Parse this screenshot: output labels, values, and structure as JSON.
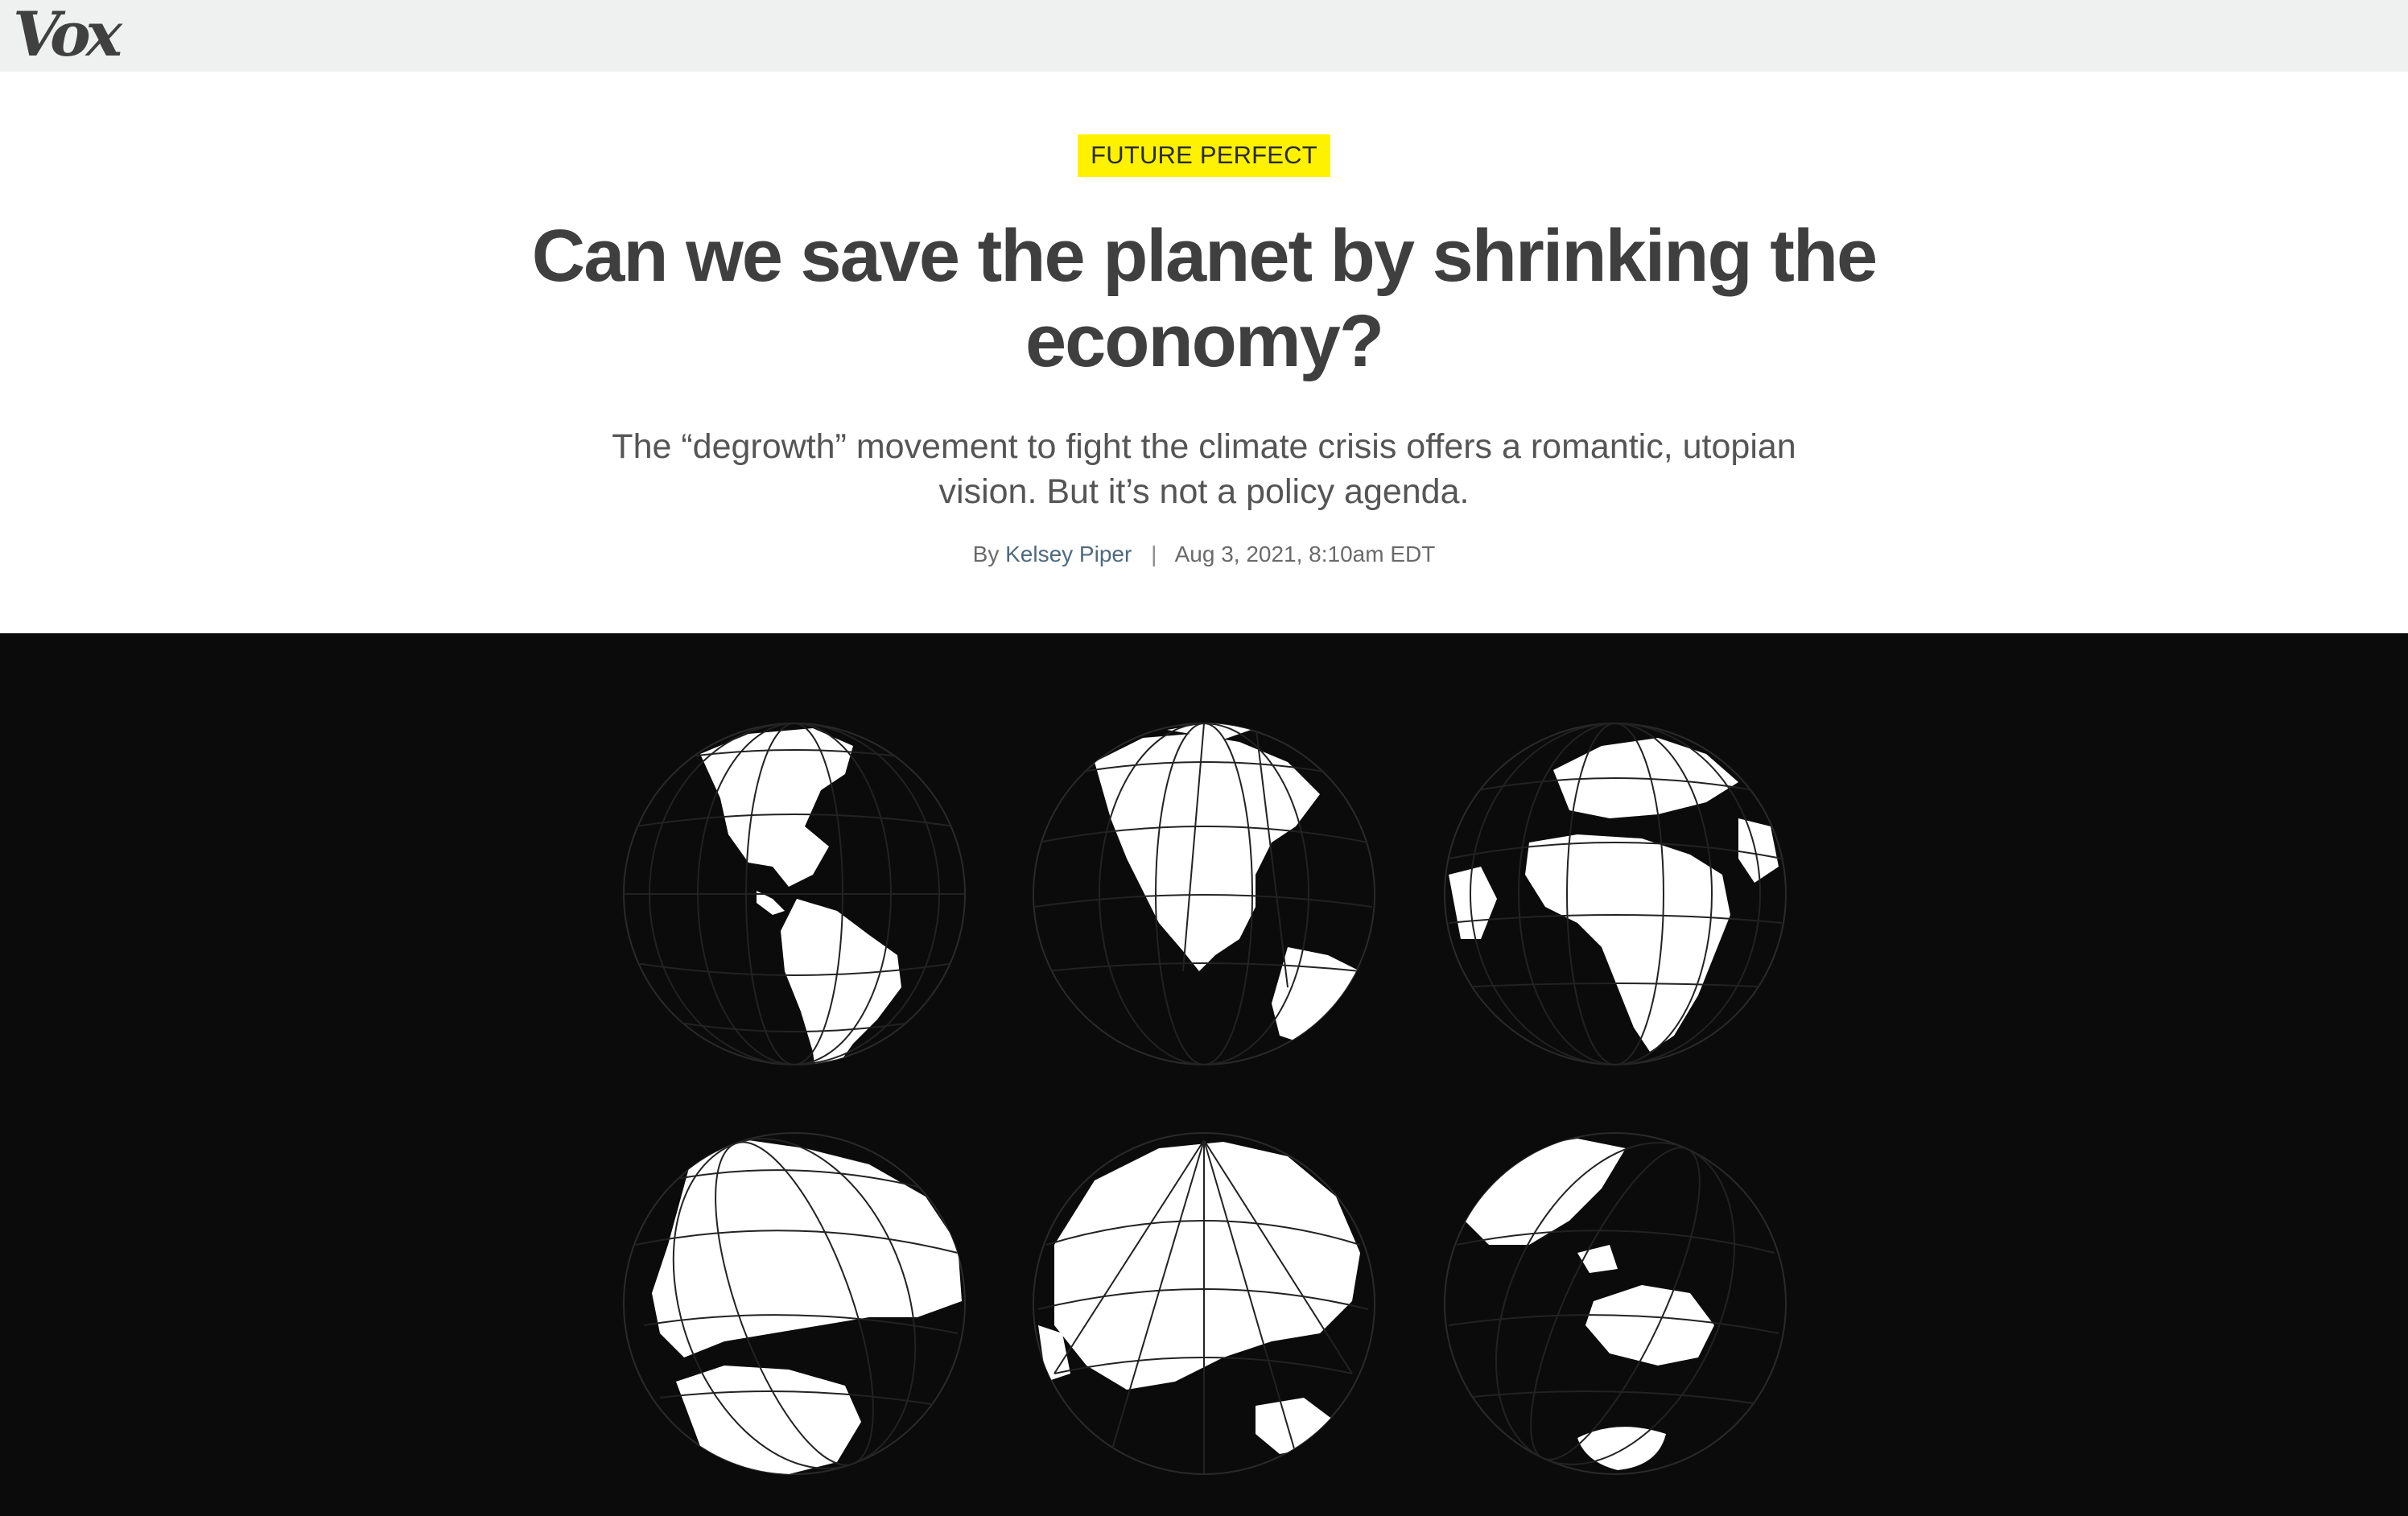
{
  "site": {
    "logo": "Vox"
  },
  "article": {
    "section": "FUTURE PERFECT",
    "headline": "Can we save the planet by shrinking the economy?",
    "dek": "The “degrowth” movement to fight the climate crisis offers a romantic, utopian vision. But it’s not a policy agenda.",
    "byline_prefix": "By",
    "author": "Kelsey Piper",
    "separator": "|",
    "timestamp": "Aug 3, 2021, 8:10am EDT"
  },
  "hero_image": {
    "globes": [
      {
        "name": "globe-americas"
      },
      {
        "name": "globe-north-america"
      },
      {
        "name": "globe-africa-europe"
      },
      {
        "name": "globe-europe-africa"
      },
      {
        "name": "globe-asia"
      },
      {
        "name": "globe-oceania"
      }
    ]
  },
  "colors": {
    "topbar_bg": "#eff1f0",
    "badge_bg": "#fff200",
    "headline": "#3f3f3f",
    "hero_bg": "#0b0b0b",
    "author_link": "#4f6a7e"
  }
}
